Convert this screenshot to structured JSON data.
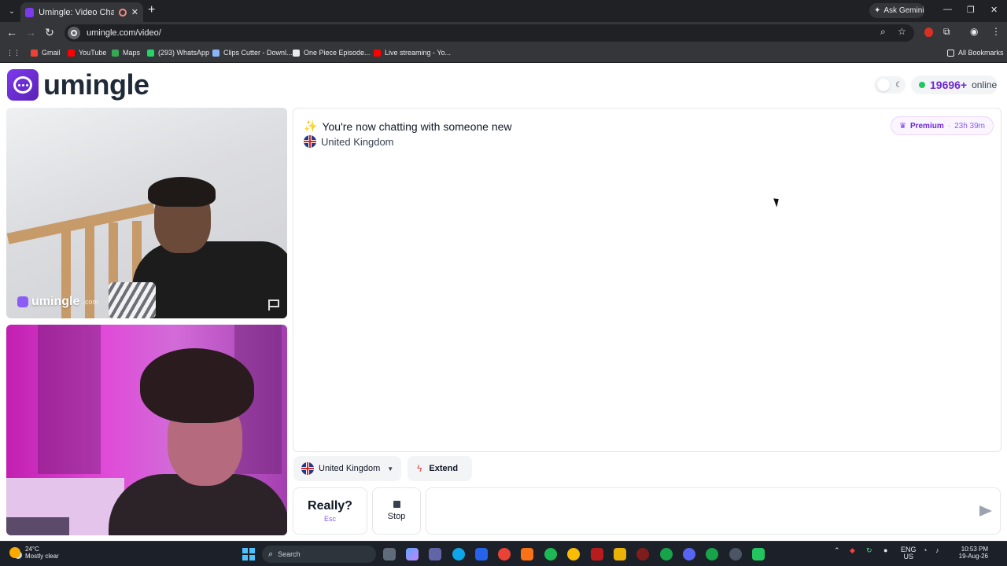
{
  "browser": {
    "tab_title": "Umingle: Video Chat with St",
    "ask_gemini": "Ask Gemini",
    "url": "umingle.com/video/",
    "bookmarks": [
      {
        "label": "Gmail",
        "color": "#ea4335"
      },
      {
        "label": "YouTube",
        "color": "#ff0000"
      },
      {
        "label": "Maps",
        "color": "#34a853"
      },
      {
        "label": "(293) WhatsApp",
        "color": "#25d366"
      },
      {
        "label": "Clips Cutter - Downl...",
        "color": "#8ab4f8"
      },
      {
        "label": "One Piece Episode...",
        "color": "#e8eaed"
      },
      {
        "label": "Live streaming - Yo...",
        "color": "#ff0000"
      }
    ],
    "all_bookmarks": "All Bookmarks"
  },
  "header": {
    "logo_text": "umingle",
    "online_count": "19696+",
    "online_label": "online"
  },
  "video_top": {
    "watermark": "umingle",
    "watermark_suffix": ".com"
  },
  "chat": {
    "status_message": "You're now chatting with someone new",
    "partner_country": "United Kingdom",
    "premium_label": "Premium",
    "premium_separator": "·",
    "premium_time": "23h 39m"
  },
  "controls": {
    "country_filter": "United Kingdom",
    "extend_label": "Extend",
    "skip_label": "Really?",
    "skip_key": "Esc",
    "stop_label": "Stop",
    "message_placeholder": ""
  },
  "taskbar": {
    "temperature": "24°C",
    "weather": "Mostly clear",
    "search_label": "Search",
    "language_1": "ENG",
    "language_2": "US",
    "time": "10:53 PM",
    "date": "19-Aug-26"
  },
  "colors": {
    "brand": "#7c3aed",
    "online_dot": "#22c55e"
  }
}
